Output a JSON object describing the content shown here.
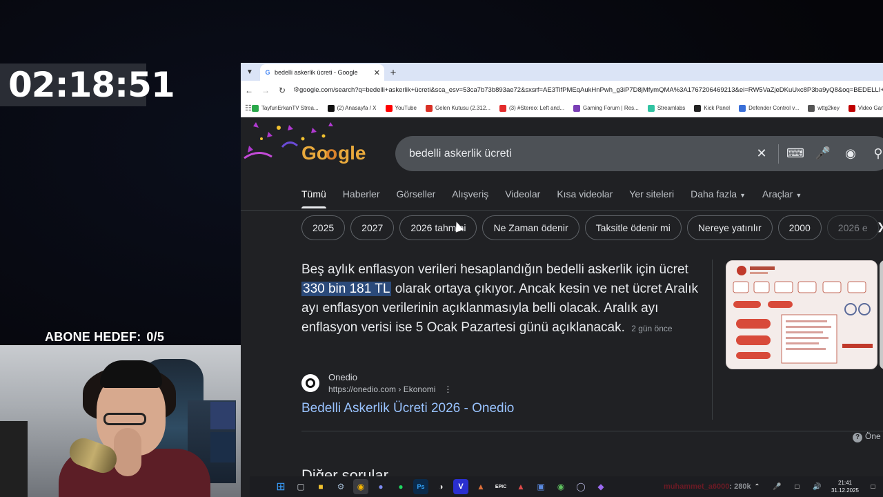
{
  "overlay": {
    "timer": "02:18:51",
    "sub_goal_label": "ABONE HEDEF:",
    "sub_goal_value": "0/5"
  },
  "browser": {
    "tab_title": "bedelli askerlik ücreti - Google",
    "url": "google.com/search?q=bedelli+askerlik+ücreti&sca_esv=53ca7b73b893ae72&sxsrf=AE3TifPMEqAukHnPwh_g3iP7D8jMfymQMA%3A1767206469213&ei=RW5VaZjeDKuUxc8P3ba9yQ8&oq=BEDELLI+A",
    "bookmarks": [
      {
        "label": "TayfunErkanTV Strea...",
        "color": "#2aa84a"
      },
      {
        "label": "(2) Anasayfa / X",
        "color": "#111111"
      },
      {
        "label": "YouTube",
        "color": "#ff0000"
      },
      {
        "label": "Gelen Kutusu (2.312...",
        "color": "#d93025"
      },
      {
        "label": "(3) #Stereo: Left and...",
        "color": "#e32b2b"
      },
      {
        "label": "Gaming Forum | Res...",
        "color": "#7a3fb5"
      },
      {
        "label": "Streamlabs",
        "color": "#31c3a2"
      },
      {
        "label": "Kick Panel",
        "color": "#222222"
      },
      {
        "label": "Defender Control v...",
        "color": "#3a6fd8"
      },
      {
        "label": "wttg2key",
        "color": "#555555"
      },
      {
        "label": "Video Game",
        "color": "#c00000"
      }
    ]
  },
  "google": {
    "query": "bedelli askerlik ücreti",
    "tabs": [
      "Tümü",
      "Haberler",
      "Görseller",
      "Alışveriş",
      "Videolar",
      "Kısa videolar",
      "Yer siteleri",
      "Daha fazla",
      "Araçlar"
    ],
    "chips": [
      "2025",
      "2027",
      "2026 tahmini",
      "Ne Zaman ödenir",
      "Taksitle ödenir mi",
      "Nereye yatırılır",
      "2000",
      "2026 e"
    ],
    "snippet_before": "Beş aylık enflasyon verileri hesaplandığın bedelli askerlik için ücret",
    "snippet_highlight": "330 bin 181 TL",
    "snippet_after": "olarak ortaya çıkıyor. Ancak kesin ve net ücret Aralık ayı enflasyon verilerinin açıklanmasıyla belli olacak. Aralık ayı enflasyon verisi ise 5 Ocak Pazartesi günü açıklanacak.",
    "snippet_age": "2 gün önce",
    "source_name": "Onedio",
    "source_url": "https://onedio.com › Ekonomi",
    "result_title": "Bedelli Askerlik Ücreti 2026 - Onedio",
    "feedback": "Öne",
    "next_heading": "Diğer sorular"
  },
  "taskbar": {
    "ticker_user": "muhammet_a6000",
    "ticker_value": ": 280k",
    "time": "21:41",
    "date": "31.12.2025"
  }
}
